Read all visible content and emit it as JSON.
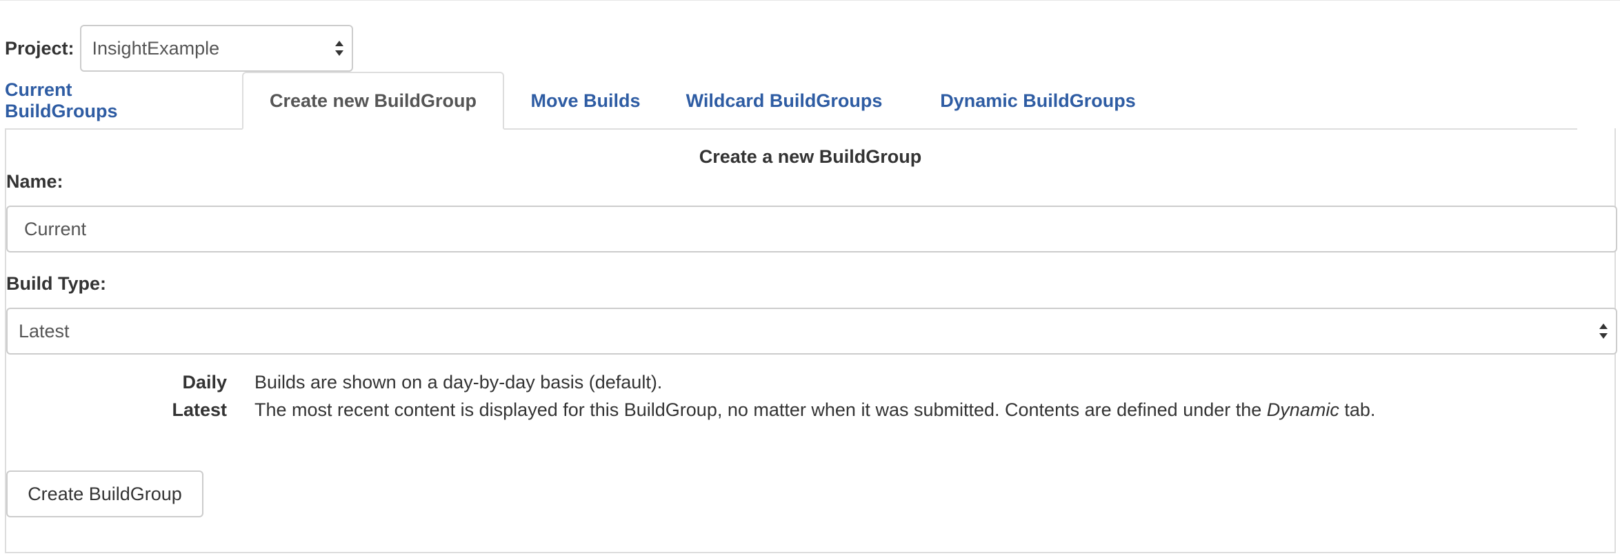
{
  "project": {
    "label": "Project:",
    "selected": "InsightExample"
  },
  "tabs": [
    {
      "label": "Current BuildGroups",
      "active": false
    },
    {
      "label": "Create new BuildGroup",
      "active": true
    },
    {
      "label": "Move Builds",
      "active": false
    },
    {
      "label": "Wildcard BuildGroups",
      "active": false
    },
    {
      "label": "Dynamic BuildGroups",
      "active": false
    }
  ],
  "form": {
    "title": "Create a new BuildGroup",
    "name_label": "Name:",
    "name_value": "Current",
    "build_type_label": "Build Type:",
    "build_type_selected": "Latest",
    "descriptions": [
      {
        "key": "Daily",
        "text": "Builds are shown on a day-by-day basis (default)."
      },
      {
        "key": "Latest",
        "text_before": "The most recent content is displayed for this BuildGroup, no matter when it was submitted. Contents are defined under the ",
        "text_em": "Dynamic",
        "text_after": " tab."
      }
    ],
    "submit_label": "Create BuildGroup"
  },
  "colors": {
    "tab_link": "#2e5ca3",
    "tab_active_text": "#555555",
    "border": "#dddddd",
    "input_border": "#cccccc"
  }
}
